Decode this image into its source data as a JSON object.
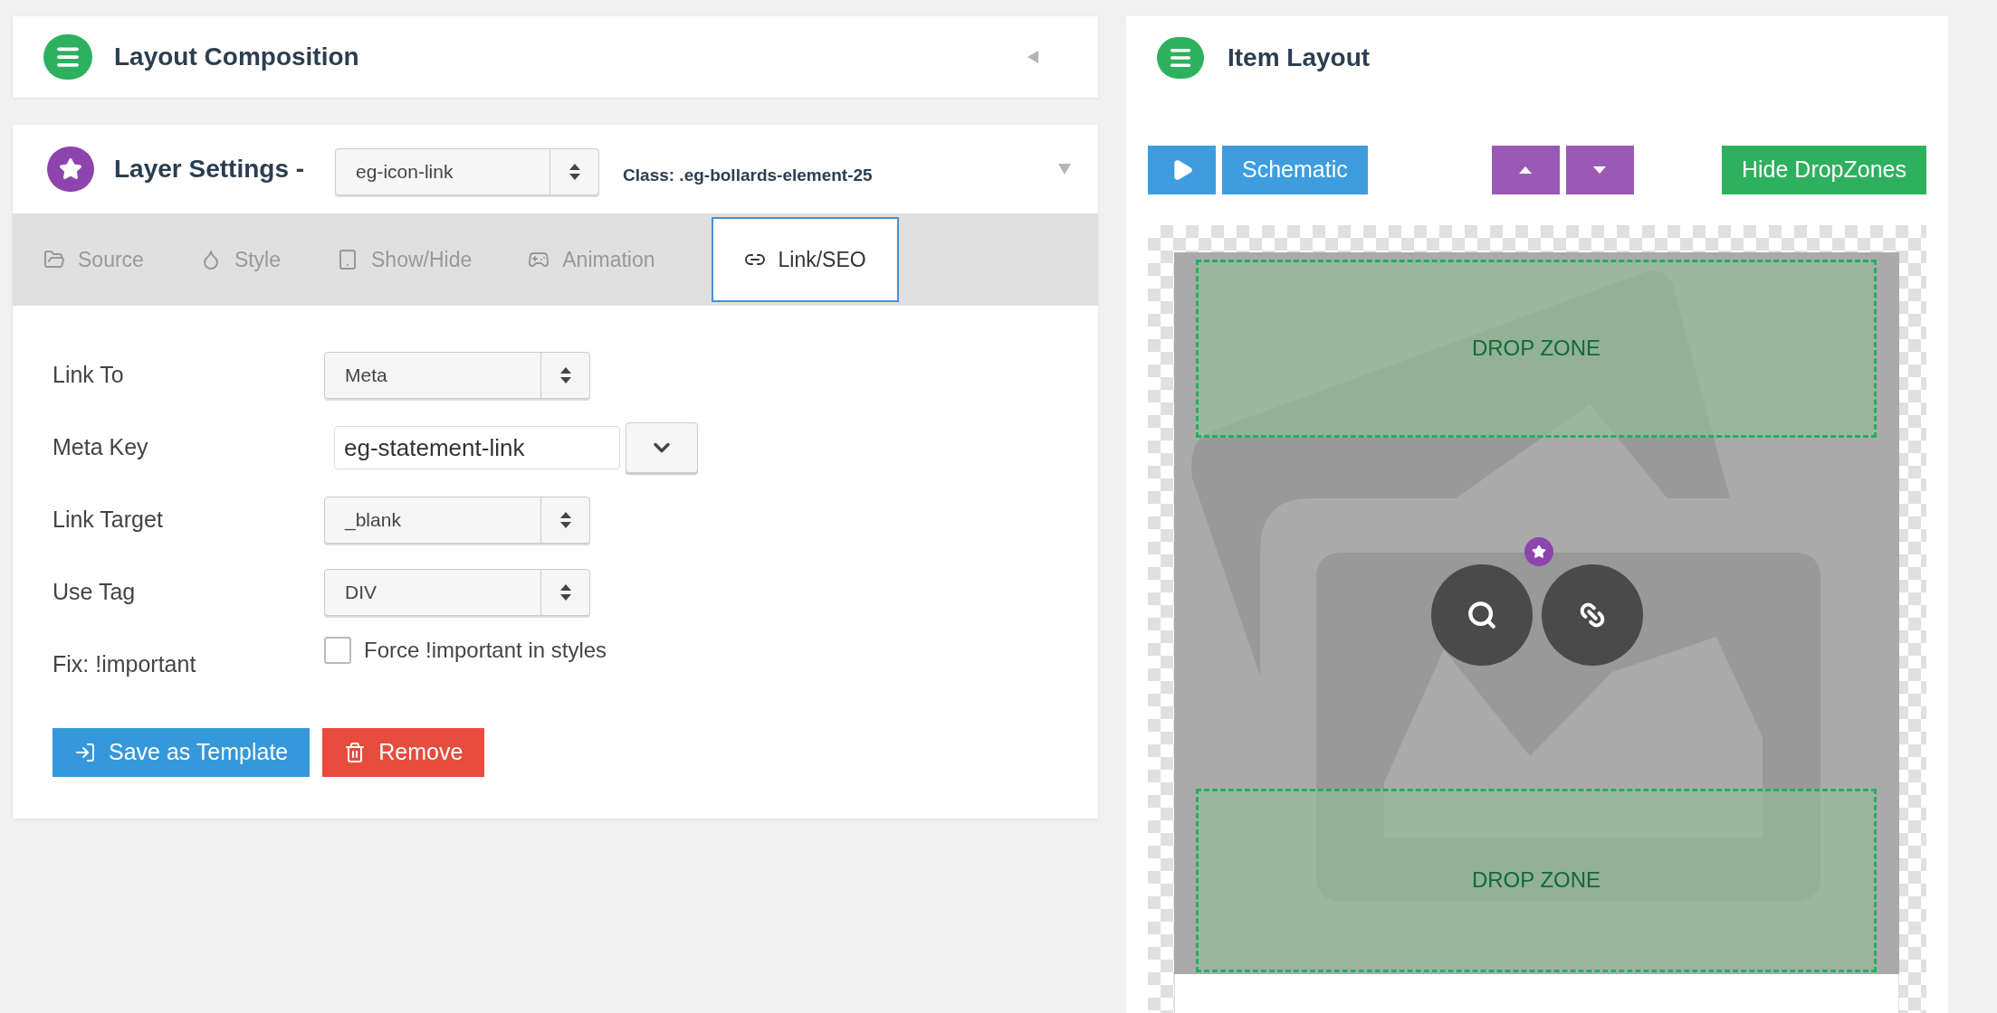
{
  "layout_composition": {
    "title": "Layout Composition",
    "expanded": false
  },
  "layer_settings": {
    "title": "Layer Settings -",
    "element_select": {
      "value": "eg-icon-link"
    },
    "class_label": "Class: .eg-bollards-element-25",
    "expanded": true
  },
  "tabs": [
    {
      "label": "Source",
      "selected": false
    },
    {
      "label": "Style",
      "selected": false
    },
    {
      "label": "Show/Hide",
      "selected": false
    },
    {
      "label": "Animation",
      "selected": false
    },
    {
      "label": "Link/SEO",
      "selected": true
    }
  ],
  "fields": [
    {
      "kind": "select",
      "label": "Link To",
      "value": "Meta"
    },
    {
      "kind": "text",
      "label": "Meta Key",
      "value": "eg-statement-link"
    },
    {
      "kind": "select",
      "label": "Link Target",
      "value": "_blank"
    },
    {
      "kind": "select",
      "label": "Use Tag",
      "value": "DIV"
    },
    {
      "kind": "checkbox",
      "label": "Fix: !important",
      "option": "Force !important in styles",
      "checked": false
    }
  ],
  "buttons": [
    {
      "kind": "save",
      "label": "Save as Template"
    },
    {
      "kind": "remove",
      "label": "Remove"
    }
  ],
  "item_layout": {
    "title": "Item Layout",
    "schematic_button": "Schematic",
    "hide_button": "Hide DropZones",
    "drop_zones": [
      {
        "label": "DROP ZONE"
      },
      {
        "label": "DROP ZONE"
      }
    ]
  }
}
